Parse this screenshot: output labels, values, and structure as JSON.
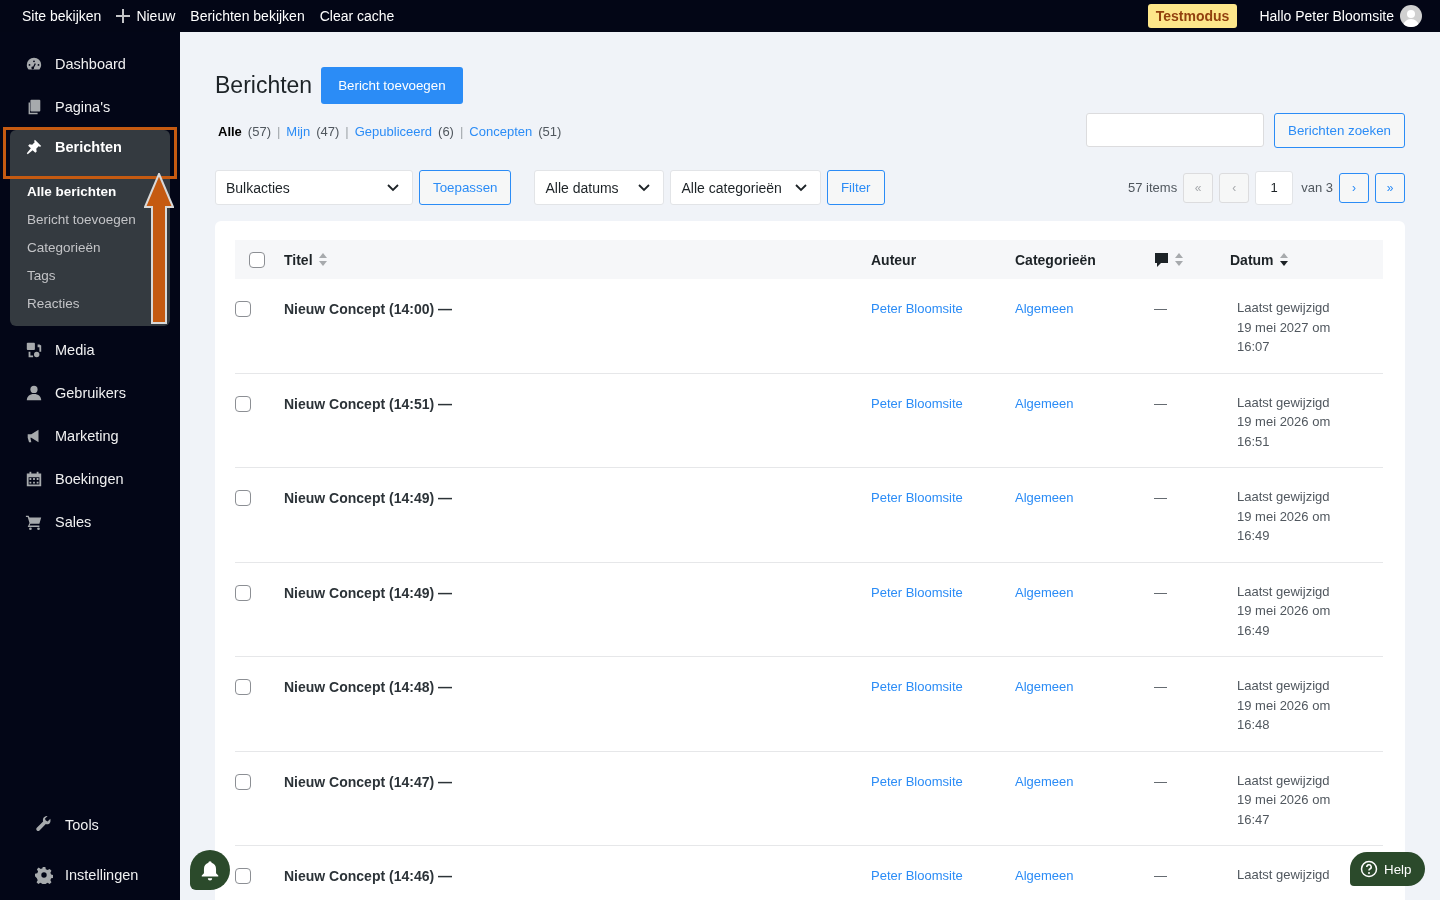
{
  "topbar": {
    "items": [
      {
        "label": "Site bekijken",
        "kind": "link"
      },
      {
        "label": "Nieuw",
        "kind": "add"
      },
      {
        "label": "Berichten bekijken",
        "kind": "link"
      },
      {
        "label": "Clear cache",
        "kind": "link"
      }
    ],
    "badge": "Testmodus",
    "greeting": "Hallo Peter Bloomsite"
  },
  "sidebar": {
    "items": [
      {
        "label": "Dashboard",
        "selected": false,
        "annotated": false
      },
      {
        "label": "Pagina's",
        "selected": false,
        "annotated": false
      },
      {
        "label": "Berichten",
        "selected": true,
        "annotated": true,
        "children": [
          {
            "label": "Alle berichten",
            "selected": true
          },
          {
            "label": "Bericht toevoegen",
            "selected": false
          },
          {
            "label": "Categorieën",
            "selected": false
          },
          {
            "label": "Tags",
            "selected": false
          },
          {
            "label": "Reacties",
            "selected": false
          }
        ]
      },
      {
        "label": "Media",
        "selected": false,
        "annotated": false
      },
      {
        "label": "Gebruikers",
        "selected": false,
        "annotated": false
      },
      {
        "label": "Marketing",
        "selected": false,
        "annotated": false
      },
      {
        "label": "Boekingen",
        "selected": false,
        "annotated": false
      },
      {
        "label": "Sales",
        "selected": false,
        "annotated": false
      }
    ],
    "footer_items": [
      {
        "label": "Tools"
      },
      {
        "label": "Instellingen"
      }
    ]
  },
  "page": {
    "title": "Berichten",
    "add_button": "Bericht toevoegen",
    "views": [
      {
        "label": "Alle",
        "count": "(57)",
        "selected": true
      },
      {
        "separator": "|",
        "label": "Mijn",
        "count": "(47)",
        "selected": false
      },
      {
        "separator": "|",
        "label": "Gepubliceerd",
        "count": "(6)",
        "selected": false
      },
      {
        "separator": "|",
        "label": "Concepten",
        "count": "(51)",
        "selected": false
      }
    ],
    "search": {
      "button": "Berichten zoeken"
    },
    "toolbar": {
      "bulk_actions": "Bulkacties",
      "apply": "Toepassen",
      "dates": "Alle datums",
      "categories": "Alle categorieën",
      "filter": "Filter"
    },
    "pagination": {
      "count": "57 items",
      "current": "1",
      "total": "van 3",
      "buttons": [
        {
          "label": "«",
          "disabled": true
        },
        {
          "label": "‹",
          "disabled": true
        },
        {
          "label": "›",
          "disabled": false
        },
        {
          "label": "»",
          "disabled": false
        }
      ]
    }
  },
  "table": {
    "select_all": {
      "checked": false
    },
    "columns": [
      {
        "kind": "text",
        "label": "Titel",
        "sortable": true,
        "sorted_descending": false
      },
      {
        "kind": "text",
        "label": "Auteur",
        "sortable": false
      },
      {
        "kind": "text",
        "label": "Categorieën",
        "sortable": false
      },
      {
        "kind": "comments",
        "sortable": true,
        "sorted_descending": false
      },
      {
        "kind": "text",
        "label": "Datum",
        "sortable": true,
        "sorted_descending": true
      }
    ],
    "rows": [
      {
        "checked": false,
        "title": "Nieuw Concept (14:00) —",
        "author": "Peter Bloomsite",
        "category": "Algemeen",
        "comments": "—",
        "date": [
          "Laatst gewijzigd",
          "19 mei 2027 om",
          "16:07"
        ]
      },
      {
        "checked": false,
        "title": "Nieuw Concept (14:51) —",
        "author": "Peter Bloomsite",
        "category": "Algemeen",
        "comments": "—",
        "date": [
          "Laatst gewijzigd",
          "19 mei 2026 om",
          "16:51"
        ]
      },
      {
        "checked": false,
        "title": "Nieuw Concept (14:49) —",
        "author": "Peter Bloomsite",
        "category": "Algemeen",
        "comments": "—",
        "date": [
          "Laatst gewijzigd",
          "19 mei 2026 om",
          "16:49"
        ]
      },
      {
        "checked": false,
        "title": "Nieuw Concept (14:49) —",
        "author": "Peter Bloomsite",
        "category": "Algemeen",
        "comments": "—",
        "date": [
          "Laatst gewijzigd",
          "19 mei 2026 om",
          "16:49"
        ]
      },
      {
        "checked": false,
        "title": "Nieuw Concept (14:48) —",
        "author": "Peter Bloomsite",
        "category": "Algemeen",
        "comments": "—",
        "date": [
          "Laatst gewijzigd",
          "19 mei 2026 om",
          "16:48"
        ]
      },
      {
        "checked": false,
        "title": "Nieuw Concept (14:47) —",
        "author": "Peter Bloomsite",
        "category": "Algemeen",
        "comments": "—",
        "date": [
          "Laatst gewijzigd",
          "19 mei 2026 om",
          "16:47"
        ]
      },
      {
        "checked": false,
        "title": "Nieuw Concept (14:46) —",
        "author": "Peter Bloomsite",
        "category": "Algemeen",
        "comments": "—",
        "date": [
          "Laatst gewijzigd"
        ]
      }
    ]
  },
  "help": {
    "label": "Help"
  }
}
